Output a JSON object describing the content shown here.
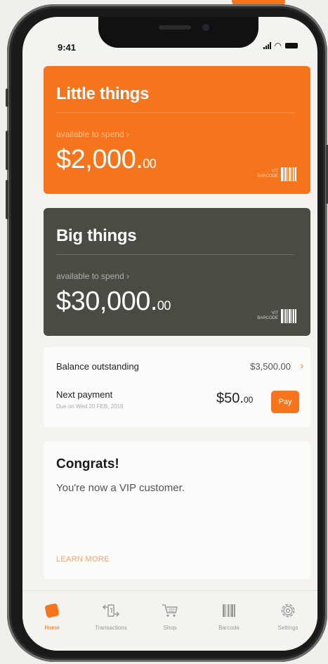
{
  "status": {
    "time": "9:41"
  },
  "cards": [
    {
      "title": "Little things",
      "subtitle": "available to spend",
      "subtitle_chevron": "›",
      "amount_main": "$2,000.",
      "amount_cents": "00",
      "barcode_label_1": "VIT",
      "barcode_label_2": "BARCODE"
    },
    {
      "title": "Big things",
      "subtitle": "available to spend",
      "subtitle_chevron": "›",
      "amount_main": "$30,000.",
      "amount_cents": "00",
      "barcode_label_1": "VIT",
      "barcode_label_2": "BARCODE"
    }
  ],
  "balance": {
    "label": "Balance outstanding",
    "value": "$3,500.00",
    "chevron": "›",
    "next_label": "Next payment",
    "next_due": "Due on Wed 20 FEB, 2019",
    "next_amount_main": "$50.",
    "next_amount_cents": "00",
    "pay_label": "Pay"
  },
  "promo": {
    "title": "Congrats!",
    "body": "You're now a VIP customer.",
    "link": "LEARN MORE"
  },
  "tabbar": {
    "items": [
      {
        "label": "Home",
        "icon": "home-icon"
      },
      {
        "label": "Transactions",
        "icon": "transactions-icon"
      },
      {
        "label": "Shop",
        "icon": "cart-icon"
      },
      {
        "label": "Barcode",
        "icon": "barcode-icon"
      },
      {
        "label": "Settings",
        "icon": "gear-icon"
      }
    ]
  },
  "colors": {
    "accent": "#f5741c",
    "dark_card": "#4a4b43",
    "background": "#f4f3f0"
  }
}
